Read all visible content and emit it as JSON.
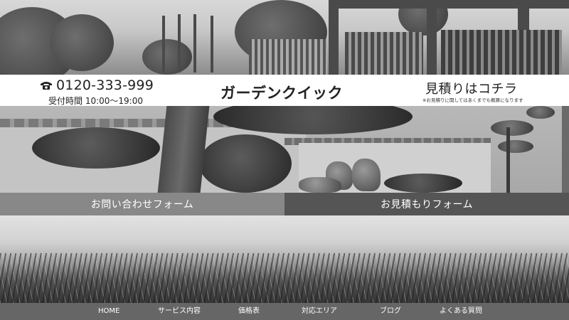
{
  "header": {
    "phone_number": "0120-333-999",
    "hours": "受付時間 10:00〜19:00",
    "brand": "ガーデンクイック",
    "estimate_title": "見積りはコチラ",
    "estimate_note": "※お見積りに関してはあくまでも概算になります",
    "phone_icon": "phone-icon"
  },
  "forms": {
    "contact_label": "お問い合わせフォーム",
    "estimate_label": "お見積もりフォーム"
  },
  "nav": {
    "items": [
      {
        "label": "HOME"
      },
      {
        "label": "サービス内容"
      },
      {
        "label": "価格表"
      },
      {
        "label": "対応エリア"
      },
      {
        "label": "ブログ"
      },
      {
        "label": "よくある質問"
      }
    ]
  },
  "colors": {
    "header_bg": "#ffffff",
    "contact_button": "#888888",
    "estimate_button": "#555555",
    "nav_bg": "#666666"
  }
}
